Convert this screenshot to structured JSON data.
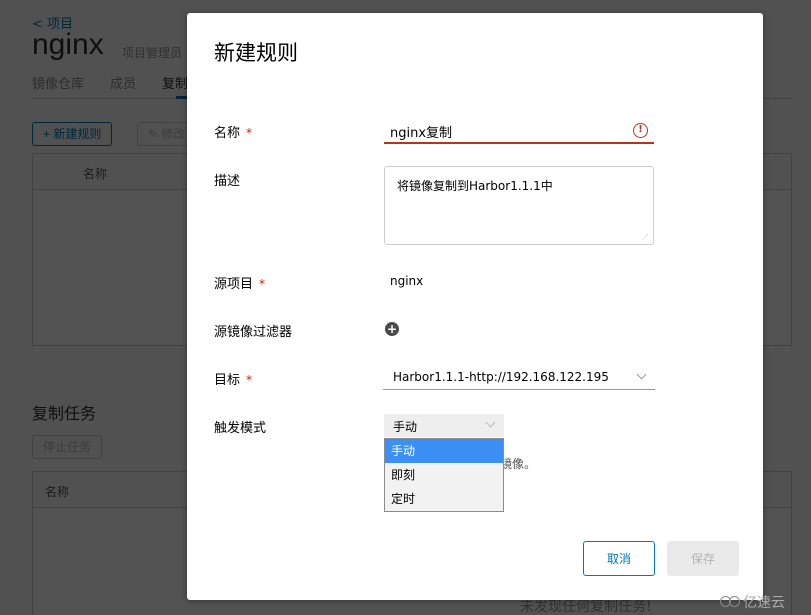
{
  "background": {
    "back_link": "< 项目",
    "project_name": "nginx",
    "project_role": "项目管理员",
    "tabs": [
      {
        "label": "镜像仓库",
        "active": false
      },
      {
        "label": "成员",
        "active": false
      },
      {
        "label": "复制",
        "active": true
      }
    ],
    "toolbar": {
      "new_rule": "+ 新建规则",
      "edit": "✎ 修改"
    },
    "rules_grid": {
      "columns": [
        "名称"
      ]
    },
    "jobs_section": {
      "title": "复制任务",
      "stop_button": "停止任务",
      "columns": [
        "名称"
      ],
      "empty_message": "未发现任何复制任务!"
    }
  },
  "modal": {
    "title": "新建规则",
    "fields": {
      "name": {
        "label": "名称",
        "required": "*",
        "value": "nginx复制",
        "error_icon": "!"
      },
      "description": {
        "label": "描述",
        "value": "将镜像复制到Harbor1.1.1中"
      },
      "source_project": {
        "label": "源项目",
        "required": "*",
        "value": "nginx"
      },
      "source_filter": {
        "label": "源镜像过滤器",
        "add_icon": "+"
      },
      "target": {
        "label": "目标",
        "required": "*",
        "value": "Harbor1.1.1-http://192.168.122.195"
      },
      "trigger_mode": {
        "label": "触发模式",
        "value": "手动",
        "hint_visible_fragment": "镜像。",
        "options": [
          {
            "label": "手动",
            "selected": true
          },
          {
            "label": "即刻",
            "selected": false
          },
          {
            "label": "定时",
            "selected": false
          }
        ]
      }
    },
    "buttons": {
      "cancel": "取消",
      "save": "保存"
    },
    "colors": {
      "error": "#b8331e",
      "primary": "#0079b8",
      "dropdown_selected": "#3c90f5"
    }
  },
  "watermark": {
    "text": "亿速云"
  }
}
